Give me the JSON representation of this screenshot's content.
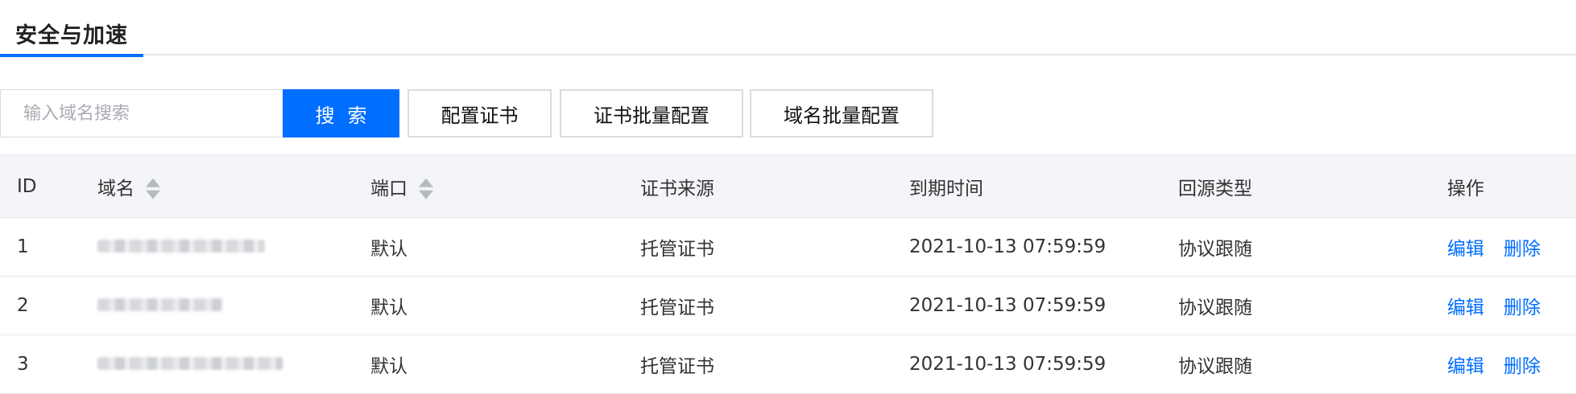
{
  "tabs": [
    {
      "label": "安全与加速",
      "active": true
    }
  ],
  "toolbar": {
    "search_placeholder": "输入域名搜索",
    "search_value": "",
    "search_label": "搜索",
    "cert_config_label": "配置证书",
    "cert_batch_label": "证书批量配置",
    "domain_batch_label": "域名批量配置"
  },
  "table": {
    "columns": {
      "id": "ID",
      "domain": "域名",
      "port": "端口",
      "source": "证书来源",
      "expire": "到期时间",
      "origin": "回源类型",
      "ops": "操作"
    },
    "rows": [
      {
        "id": "1",
        "port": "默认",
        "source": "托管证书",
        "expire": "2021-10-13 07:59:59",
        "origin": "协议跟随",
        "edit": "编辑",
        "delete": "删除"
      },
      {
        "id": "2",
        "port": "默认",
        "source": "托管证书",
        "expire": "2021-10-13 07:59:59",
        "origin": "协议跟随",
        "edit": "编辑",
        "delete": "删除"
      },
      {
        "id": "3",
        "port": "默认",
        "source": "托管证书",
        "expire": "2021-10-13 07:59:59",
        "origin": "协议跟随",
        "edit": "编辑",
        "delete": "删除"
      }
    ]
  },
  "colors": {
    "accent": "#006eff",
    "header_bg": "#f3f5f8",
    "border": "#e4e6ea"
  }
}
